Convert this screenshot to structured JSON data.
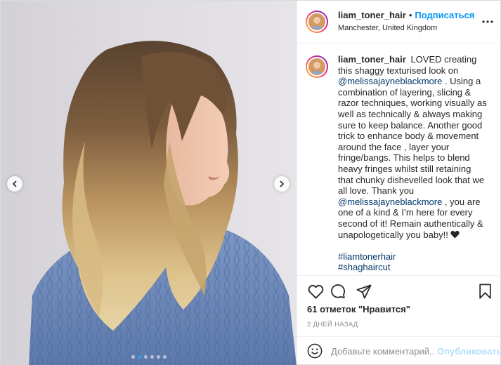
{
  "post": {
    "username": "liam_toner_hair",
    "separator": "•",
    "follow_label": "Подписаться",
    "location": "Manchester, United Kingdom",
    "more_icon": "more-horizontal-icon"
  },
  "caption": {
    "username": "liam_toner_hair",
    "part1": "LOVED creating this shaggy texturised look on ",
    "mention1": "@melissajayneblackmore",
    "part2": " . Using a combination of layering, slicing & razor techniques, working visually as well as technically & always making sure to keep balance. Another good trick to enhance body & movement around the face , layer your fringe/bangs. This helps to blend heavy fringes whilst still retaining that chunky dishevelled look that we all love. Thank you ",
    "mention2": "@melissajayneblackmore",
    "part3": " , you are one of a kind & I’m here for every second of it! Remain authentically & unapologetically you baby!! ",
    "emoji": "black-heart-emoji",
    "hashtags": [
      "#liamtonerhair",
      "#shaghaircut"
    ]
  },
  "actions": {
    "like_icon": "heart-icon",
    "comment_icon": "comment-icon",
    "share_icon": "paper-plane-icon",
    "save_icon": "bookmark-icon"
  },
  "likes_text": "61 отметок \"Нравится\"",
  "time_text": "2 ДНЕЙ НАЗАД",
  "comment": {
    "placeholder": "Добавьте комментарий...",
    "value": "",
    "publish_label": "Опубликовать",
    "emoji_icon": "smiley-icon"
  },
  "carousel": {
    "slide_count": 6,
    "active_slide": 2,
    "prev_icon": "chevron-left-icon",
    "next_icon": "chevron-right-icon"
  },
  "colors": {
    "accent_blue": "#0095f6",
    "publish_disabled": "#b2dffc",
    "link_dark": "#00376b",
    "muted": "#8e8e8e"
  }
}
